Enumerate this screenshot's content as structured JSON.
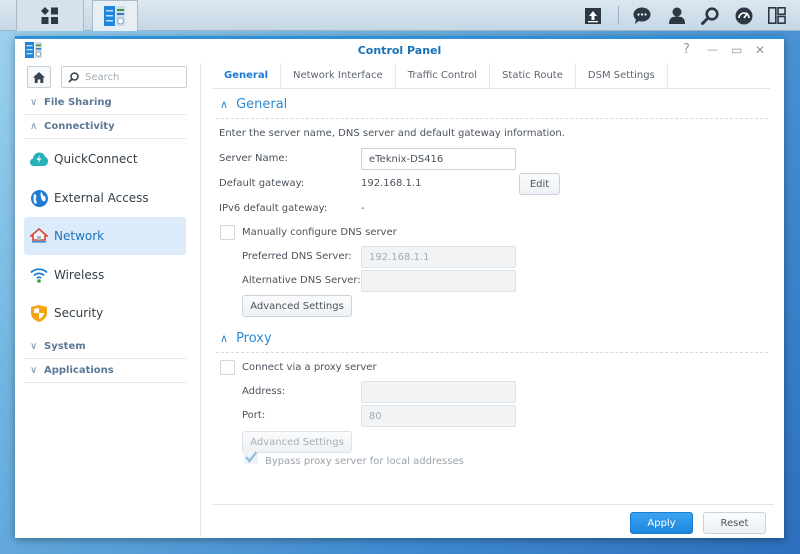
{
  "taskbar": {
    "left_icons": [
      "main-menu-icon",
      "control-panel-app-icon"
    ],
    "right_icons": [
      "upload-icon",
      "notifications-icon",
      "user-icon",
      "search-icon",
      "resource-monitor-icon",
      "widgets-icon"
    ]
  },
  "window": {
    "title": "Control Panel",
    "controls": {
      "help": "?",
      "minimize": "—",
      "maximize": "▭",
      "close": "✕"
    }
  },
  "sidebar": {
    "search_placeholder": "Search",
    "categories": [
      {
        "label": "File Sharing",
        "expanded": false
      },
      {
        "label": "Connectivity",
        "expanded": true
      },
      {
        "label": "System",
        "expanded": false
      },
      {
        "label": "Applications",
        "expanded": false
      }
    ],
    "items": [
      {
        "label": "QuickConnect",
        "icon": "quickconnect-icon"
      },
      {
        "label": "External Access",
        "icon": "globe-icon"
      },
      {
        "label": "Network",
        "icon": "network-house-icon",
        "active": true
      },
      {
        "label": "Wireless",
        "icon": "wifi-icon"
      },
      {
        "label": "Security",
        "icon": "shield-icon"
      }
    ]
  },
  "tabs": [
    {
      "label": "General",
      "active": true
    },
    {
      "label": "Network Interface"
    },
    {
      "label": "Traffic Control"
    },
    {
      "label": "Static Route"
    },
    {
      "label": "DSM Settings"
    }
  ],
  "general": {
    "heading": "General",
    "description": "Enter the server name, DNS server and default gateway information.",
    "server_name_label": "Server Name:",
    "server_name_value": "eTeknix-DS416",
    "gateway_label": "Default gateway:",
    "gateway_value": "192.168.1.1",
    "edit_label": "Edit",
    "ipv6_label": "IPv6 default gateway:",
    "ipv6_value": "-",
    "manual_dns_label": "Manually configure DNS server",
    "manual_dns_checked": false,
    "preferred_dns_label": "Preferred DNS Server:",
    "preferred_dns_value": "192.168.1.1",
    "alternative_dns_label": "Alternative DNS Server:",
    "alternative_dns_value": "",
    "advanced_label": "Advanced Settings"
  },
  "proxy": {
    "heading": "Proxy",
    "connect_label": "Connect via a proxy server",
    "connect_checked": false,
    "address_label": "Address:",
    "address_value": "",
    "port_label": "Port:",
    "port_value": "80",
    "advanced_label": "Advanced Settings",
    "bypass_label": "Bypass proxy server for local addresses",
    "bypass_checked": true
  },
  "footer": {
    "apply_label": "Apply",
    "reset_label": "Reset"
  }
}
